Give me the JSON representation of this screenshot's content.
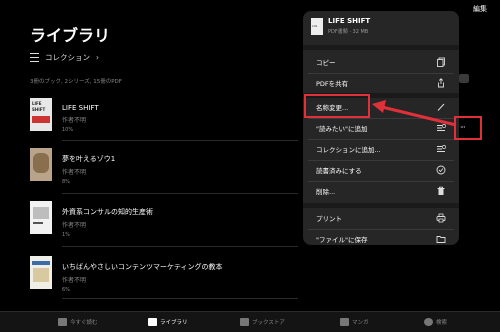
{
  "header": {
    "edit_label": "編集",
    "title": "ライブラリ",
    "collection_label": "コレクション",
    "summary": "3冊のブック, 2シリーズ, 15冊のPDF"
  },
  "books": [
    {
      "title": "LIFE SHIFT",
      "author": "作者不明",
      "progress": "10%"
    },
    {
      "title": "夢を叶えるゾウ1",
      "author": "作者不明",
      "progress": "8%"
    },
    {
      "title": "外資系コンサルの知的生産術",
      "author": "作者不明",
      "progress": "1%"
    },
    {
      "title": "いちばんやさしいコンテンツマーケティングの教本",
      "author": "作者不明",
      "progress": "6%"
    }
  ],
  "menu": {
    "book_title": "LIFE SHIFT",
    "book_sub": "PDF書類 · 32 MB",
    "items": [
      {
        "label": "コピー",
        "icon": "copy-icon"
      },
      {
        "label": "PDFを共有",
        "icon": "share-icon"
      },
      {
        "label": "名称変更...",
        "icon": "pencil-icon"
      },
      {
        "label": "\"読みたい\"に追加",
        "icon": "list-add-icon"
      },
      {
        "label": "コレクションに追加...",
        "icon": "list-add-icon"
      },
      {
        "label": "読書済みにする",
        "icon": "checkmark-icon"
      },
      {
        "label": "削除...",
        "icon": "trash-icon"
      },
      {
        "label": "プリント",
        "icon": "printer-icon"
      },
      {
        "label": "\"ファイル\"に保存",
        "icon": "folder-icon"
      }
    ]
  },
  "more_button": "···",
  "tabs": [
    {
      "label": "今すぐ読む",
      "icon": "book-open-icon"
    },
    {
      "label": "ライブラリ",
      "icon": "library-icon"
    },
    {
      "label": "ブックストア",
      "icon": "bookstore-icon"
    },
    {
      "label": "マンガ",
      "icon": "manga-icon"
    },
    {
      "label": "検索",
      "icon": "search-icon"
    }
  ],
  "colors": {
    "highlight": "#e0303a",
    "menu_bg": "#262626",
    "background": "#000000"
  }
}
